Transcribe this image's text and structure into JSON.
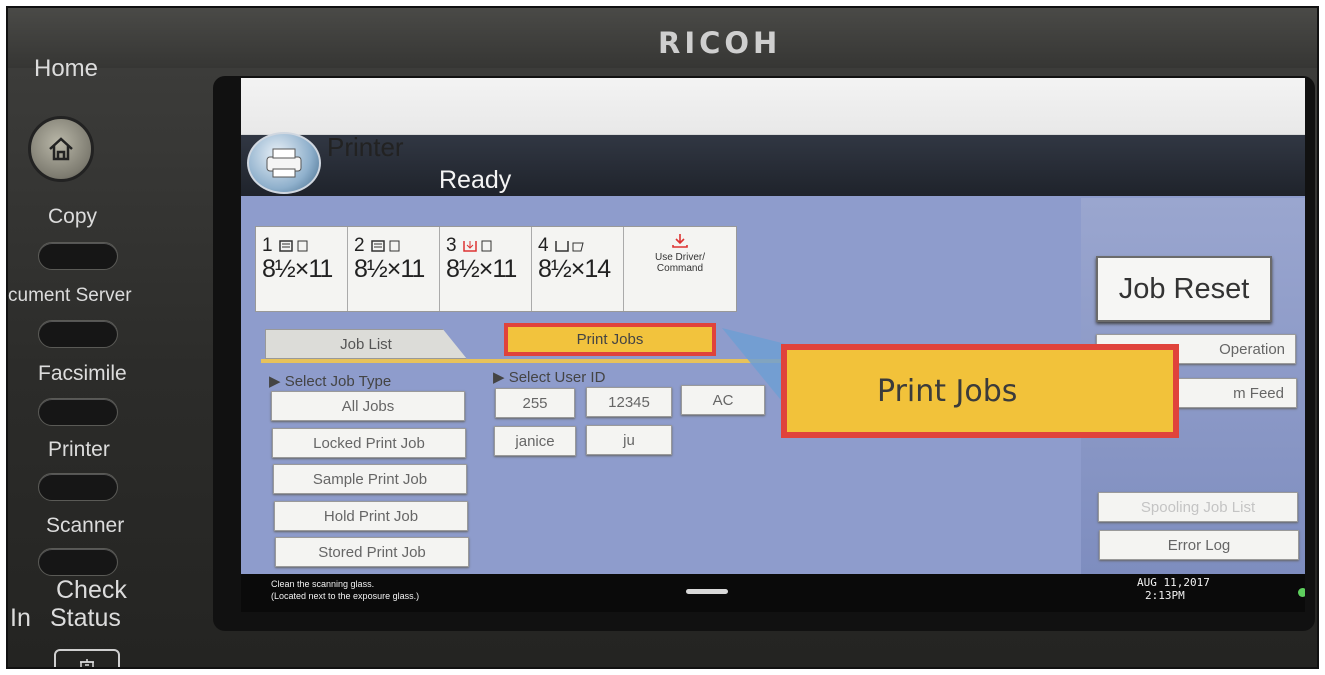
{
  "brand": "RICOH",
  "left_panel": {
    "home_label": "Home",
    "items": [
      {
        "label": "Copy"
      },
      {
        "label": "cument Server"
      },
      {
        "label": "Facsimile"
      },
      {
        "label": "Printer"
      },
      {
        "label": "Scanner"
      }
    ],
    "check_status": [
      "Check",
      "Status"
    ],
    "check_status_prefix": "In"
  },
  "screen": {
    "title": "Printer",
    "status": "Ready",
    "trays": [
      {
        "number": "1",
        "size": "8½×11"
      },
      {
        "number": "2",
        "size": "8½×11"
      },
      {
        "number": "3",
        "size": "8½×11"
      },
      {
        "number": "4",
        "size": "8½×14"
      }
    ],
    "use_driver": [
      "Use Driver/",
      "Command"
    ],
    "tabs": {
      "job_list": "Job List",
      "print_jobs": "Print Jobs"
    },
    "select_job_type": {
      "label": "Select Job Type",
      "options": [
        "All Jobs",
        "Locked Print Job",
        "Sample Print Job",
        "Hold Print Job",
        "Stored Print Job"
      ]
    },
    "select_user_id": {
      "label": "Select User ID",
      "users": [
        "255",
        "12345",
        "AC",
        "janice",
        "ju"
      ]
    },
    "right_panel": {
      "job_reset": "Job Reset",
      "operation": "Operation",
      "form_feed": "m Feed",
      "spooling_job_list": "Spooling Job List",
      "error_log": "Error Log"
    },
    "status_bar": {
      "message_line1": "Clean the scanning glass.",
      "message_line2": "(Located next to the exposure glass.)",
      "date": "AUG  11,2017",
      "time": "2:13PM"
    }
  },
  "zoom_callout": {
    "label": "Print Jobs",
    "highlight_color": "#e0433b",
    "fill_color": "#f2c23a"
  }
}
